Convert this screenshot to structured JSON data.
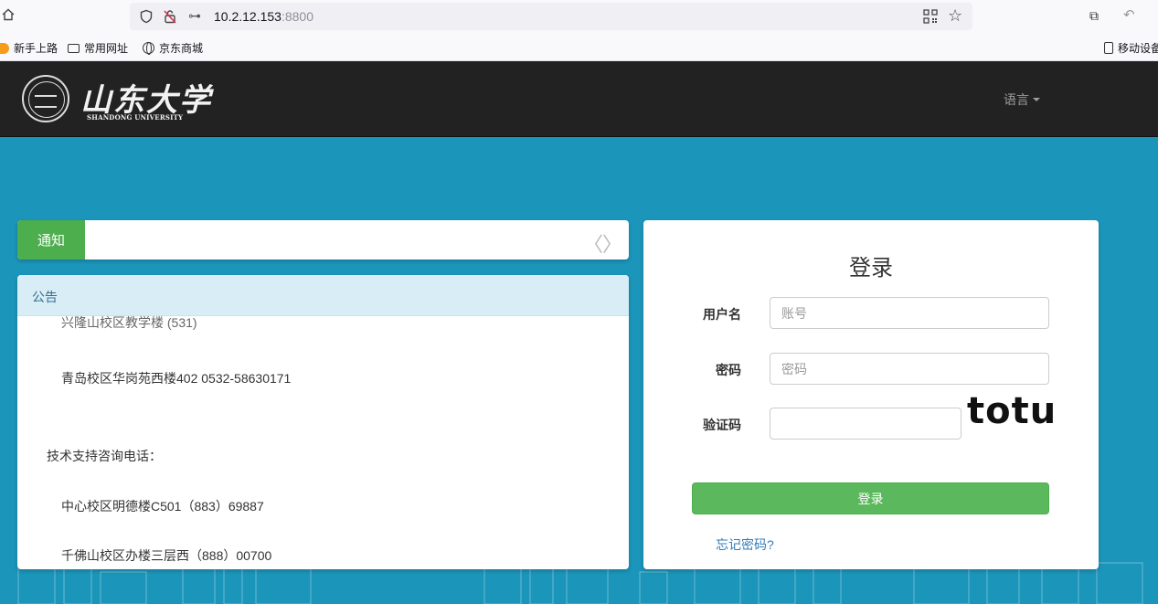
{
  "browser": {
    "url_host": "10.2.12.153",
    "url_port": ":8800",
    "bookmarks": [
      "新手上路",
      "常用网址",
      "京东商城"
    ],
    "mobile_bookmarks": "移动设备"
  },
  "header": {
    "logo_cn": "山东大学",
    "logo_en": "SHANDONG UNIVERSITY",
    "language_label": "语言"
  },
  "notice": {
    "tag": "通知",
    "prev": "〈",
    "next": "〉"
  },
  "announcement": {
    "title": "公告",
    "lines": [
      "兴隆山校区教学楼 (531)",
      "青岛校区华岗苑西楼402   0532-58630171",
      "技术支持咨询电话：",
      "中心校区明德楼C501（883）69887",
      "千佛山校区办楼三层西（888）00700"
    ]
  },
  "login": {
    "title": "登录",
    "username_label": "用户名",
    "username_placeholder": "账号",
    "password_label": "密码",
    "password_placeholder": "密码",
    "captcha_label": "验证码",
    "captcha_value": "",
    "captcha_image_text": "totu",
    "submit_label": "登录",
    "forgot_label": "忘记密码?"
  }
}
